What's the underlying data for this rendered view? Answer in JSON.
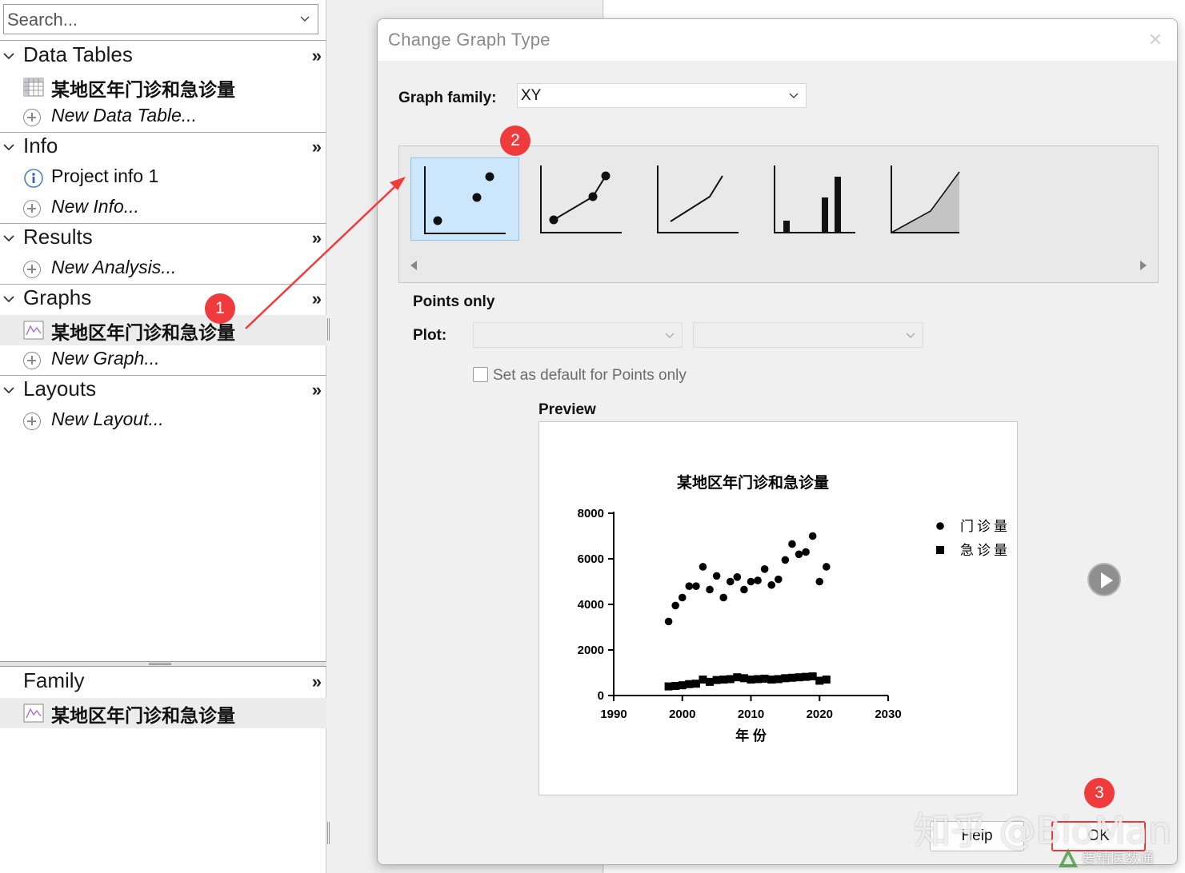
{
  "navigator": {
    "search_placeholder": "Search...",
    "sections": [
      {
        "title": "Data Tables",
        "items": [
          "某地区年门诊和急诊量",
          "New Data Table..."
        ]
      },
      {
        "title": "Info",
        "items": [
          "Project info 1",
          "New Info..."
        ]
      },
      {
        "title": "Results",
        "items": [
          "New Analysis..."
        ]
      },
      {
        "title": "Graphs",
        "items": [
          "某地区年门诊和急诊量",
          "New Graph..."
        ]
      },
      {
        "title": "Layouts",
        "items": [
          "New Layout..."
        ]
      }
    ],
    "family": {
      "title": "Family",
      "items": [
        "某地区年门诊和急诊量"
      ]
    },
    "more_glyph": "»"
  },
  "dialog": {
    "title": "Change Graph Type",
    "graph_family_label": "Graph family:",
    "graph_family_value": "XY",
    "graph_types": [
      "points-only",
      "points-connected",
      "line-only",
      "spikes",
      "area-fill"
    ],
    "selected_type_index": 0,
    "selected_type_label": "Points only",
    "plot_label": "Plot:",
    "default_checkbox_label": "Set as default for Points only",
    "default_checked": false,
    "preview_label": "Preview",
    "help_label": "Help",
    "ok_label": "OK"
  },
  "annotations": {
    "badge1": "1",
    "badge2": "2",
    "badge3": "3",
    "color": "#ef3b3b"
  },
  "watermark": {
    "text": "知乎 @BioMan",
    "site": "要精医数通"
  },
  "chart_data": {
    "type": "scatter",
    "title": "某地区年门诊和急诊量",
    "xlabel": "年 份",
    "ylabel": "",
    "xlim": [
      1990,
      2030
    ],
    "ylim": [
      0,
      8000
    ],
    "x_ticks": [
      1990,
      2000,
      2010,
      2020,
      2030
    ],
    "y_ticks": [
      0,
      2000,
      4000,
      6000,
      8000
    ],
    "legend_position": "top-right",
    "series": [
      {
        "name": "门诊量",
        "marker": "circle",
        "points": [
          [
            1998,
            3250
          ],
          [
            1999,
            3950
          ],
          [
            2000,
            4300
          ],
          [
            2001,
            4800
          ],
          [
            2002,
            4800
          ],
          [
            2003,
            5650
          ],
          [
            2004,
            4650
          ],
          [
            2005,
            5250
          ],
          [
            2006,
            4300
          ],
          [
            2007,
            5000
          ],
          [
            2008,
            5200
          ],
          [
            2009,
            4650
          ],
          [
            2010,
            5000
          ],
          [
            2011,
            5050
          ],
          [
            2012,
            5550
          ],
          [
            2013,
            4850
          ],
          [
            2014,
            5100
          ],
          [
            2015,
            5950
          ],
          [
            2016,
            6650
          ],
          [
            2017,
            6200
          ],
          [
            2018,
            6300
          ],
          [
            2019,
            7000
          ],
          [
            2020,
            5000
          ],
          [
            2021,
            5650
          ]
        ]
      },
      {
        "name": "急诊量",
        "marker": "square",
        "points": [
          [
            1998,
            400
          ],
          [
            1999,
            420
          ],
          [
            2000,
            450
          ],
          [
            2001,
            500
          ],
          [
            2002,
            520
          ],
          [
            2003,
            700
          ],
          [
            2004,
            600
          ],
          [
            2005,
            680
          ],
          [
            2006,
            700
          ],
          [
            2007,
            720
          ],
          [
            2008,
            800
          ],
          [
            2009,
            760
          ],
          [
            2010,
            700
          ],
          [
            2011,
            720
          ],
          [
            2012,
            740
          ],
          [
            2013,
            700
          ],
          [
            2014,
            720
          ],
          [
            2015,
            760
          ],
          [
            2016,
            780
          ],
          [
            2017,
            800
          ],
          [
            2018,
            820
          ],
          [
            2019,
            840
          ],
          [
            2020,
            650
          ],
          [
            2021,
            700
          ]
        ]
      }
    ]
  }
}
